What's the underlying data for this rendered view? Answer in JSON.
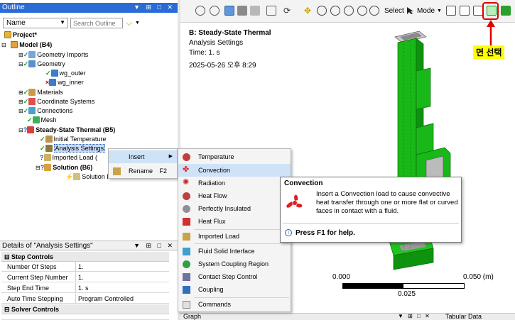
{
  "outline": {
    "title": "Outline",
    "window_controls": "▼ ⊞ □ ✕",
    "name_dropdown": "Name",
    "search_placeholder": "Search Outline",
    "tree": {
      "project": "Project*",
      "model": "Model (B4)",
      "geometry_imports": "Geometry Imports",
      "geometry": "Geometry",
      "wg_outer": "wg_outer",
      "wg_inner": "wg_inner",
      "materials": "Materials",
      "coordinate_systems": "Coordinate Systems",
      "connections": "Connections",
      "mesh": "Mesh",
      "steady_state": "Steady-State Thermal (B5)",
      "initial_temperature": "Initial Temperature",
      "analysis_settings": "Analysis Settings",
      "imported_load": "Imported Load (",
      "solution": "Solution (B6)",
      "solution_info": "Solution Information"
    }
  },
  "details": {
    "title": "Details of \"Analysis Settings\"",
    "window_controls": "▼ ⊞ □ ✕",
    "groups": {
      "step_controls": "Step Controls",
      "solver_controls": "Solver Controls"
    },
    "rows": {
      "number_of_steps": {
        "key": "Number Of Steps",
        "value": "1."
      },
      "current_step": {
        "key": "Current Step Number",
        "value": "1."
      },
      "step_end_time": {
        "key": "Step End Time",
        "value": "1. s"
      },
      "auto_time_stepping": {
        "key": "Auto Time Stepping",
        "value": "Program Controlled"
      }
    }
  },
  "toolbar": {
    "select_label": "Select",
    "mode_label": "Mode"
  },
  "viewport": {
    "title": "B: Steady-State Thermal",
    "line1": "Analysis Settings",
    "line2": "Time: 1. s",
    "line3": "2025-05-26 오후 8:29",
    "scale_left": "0.000",
    "scale_right": "0.050 (m)",
    "scale_mid": "0.025"
  },
  "annotation": {
    "label": "면 선택",
    "color": "#e00000"
  },
  "context_menu": {
    "insert": "Insert",
    "rename": "Rename",
    "rename_shortcut": "F2"
  },
  "insert_menu": {
    "temperature": "Temperature",
    "convection": "Convection",
    "radiation": "Radiation",
    "heat_flow": "Heat Flow",
    "perfectly_insulated": "Perfectly Insulated",
    "heat_flux": "Heat Flux",
    "imported_load": "Imported Load",
    "fluid_solid": "Fluid Solid Interface",
    "system_coupling": "System Coupling Region",
    "contact_step": "Contact Step Control",
    "coupling": "Coupling",
    "commands": "Commands"
  },
  "tooltip": {
    "title": "Convection",
    "body": "Insert a Convection load to cause convective heat transfer through one or more flat or curved faces in contact with a fluid.",
    "help": "Press F1 for help."
  },
  "bottom": {
    "graph_tab": "Graph",
    "tabular_tab": "Tabular Data"
  }
}
